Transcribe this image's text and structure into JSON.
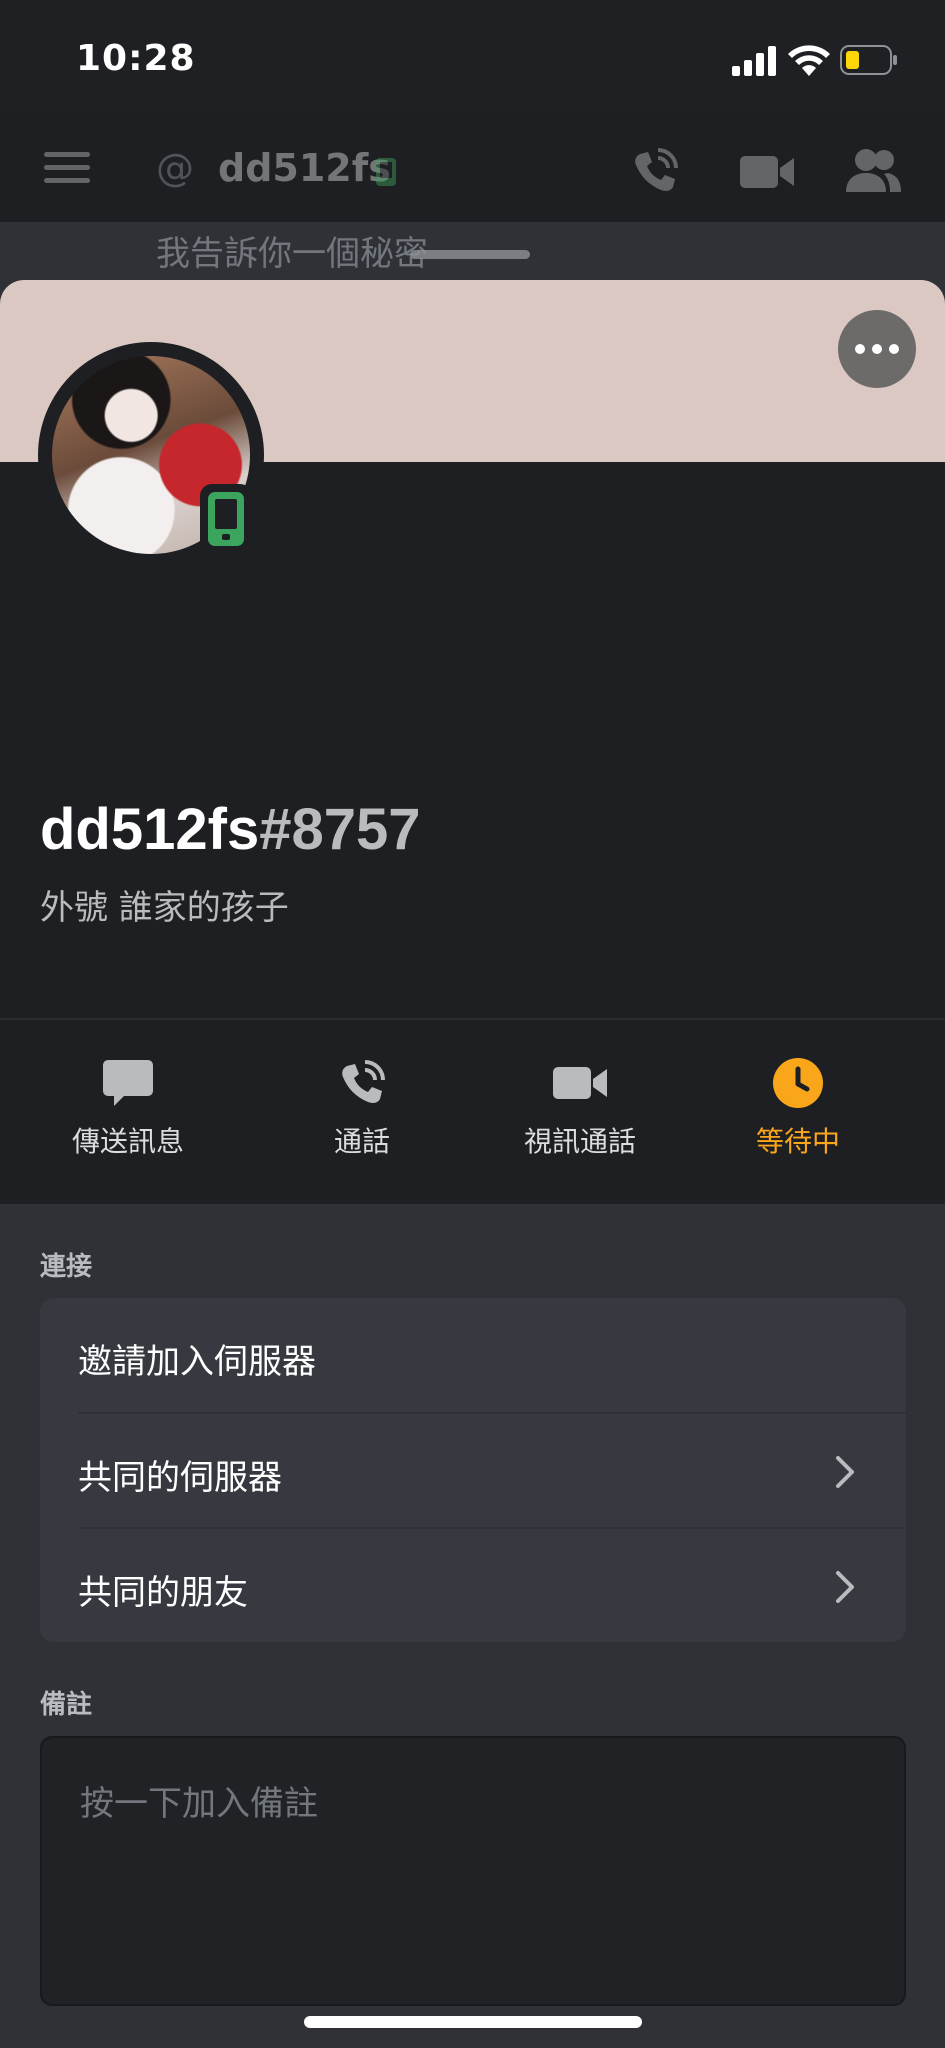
{
  "status_bar": {
    "time": "10:28"
  },
  "chat_header": {
    "at_symbol": "@",
    "username": "dd512fs",
    "preview_message": "我告訴你一個秘密"
  },
  "profile": {
    "username": "dd512fs",
    "discriminator": "#8757",
    "custom_status": "外號  誰家的孩子",
    "banner_color": "#dbc8c3",
    "online_status": "mobile-online"
  },
  "actions": [
    {
      "label": "傳送訊息",
      "icon": "chat-bubble-icon"
    },
    {
      "label": "通話",
      "icon": "phone-call-icon"
    },
    {
      "label": "視訊通話",
      "icon": "video-camera-icon"
    },
    {
      "label": "等待中",
      "icon": "clock-icon"
    }
  ],
  "connections": {
    "title": "連接",
    "items": [
      {
        "label": "邀請加入伺服器",
        "has_chevron": false
      },
      {
        "label": "共同的伺服器",
        "has_chevron": true
      },
      {
        "label": "共同的朋友",
        "has_chevron": true
      }
    ]
  },
  "note": {
    "title": "備註",
    "placeholder": "按一下加入備註"
  },
  "colors": {
    "pending_accent": "#faa61a",
    "online_green": "#3ba55d"
  }
}
